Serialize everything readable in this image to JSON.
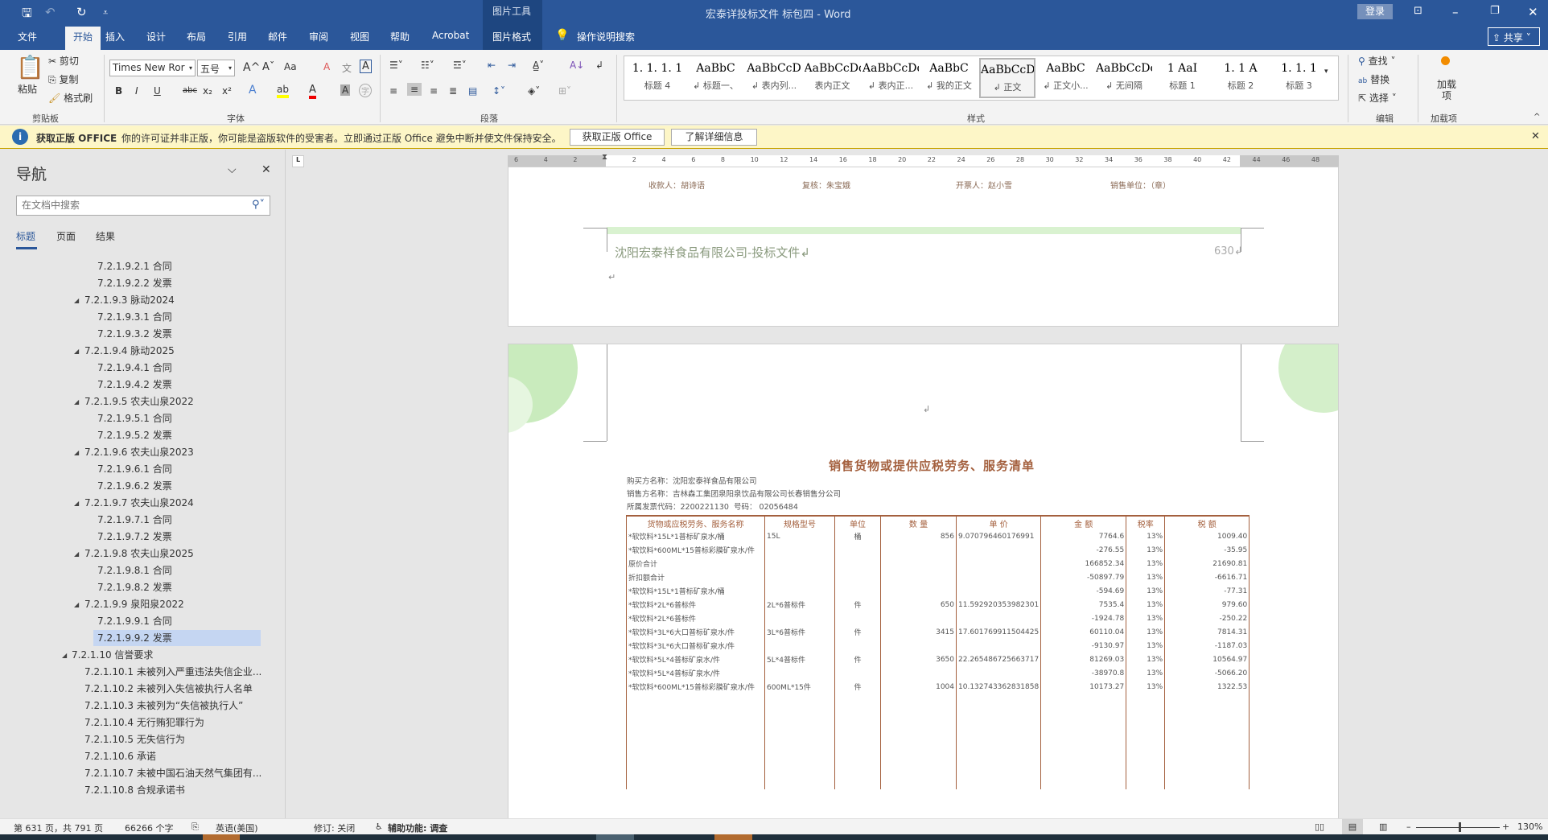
{
  "titlebar": {
    "quick_access": [
      "save-icon",
      "undo-icon",
      "redo-icon",
      "customize-icon"
    ],
    "context_tab_group": "图片工具",
    "title": "宏泰详投标文件 标包四  -  Word",
    "login": "登录",
    "window_controls": [
      "ribbon-display-icon",
      "minimize-icon",
      "restore-icon",
      "close-icon"
    ]
  },
  "tabs": [
    "文件",
    "开始",
    "插入",
    "设计",
    "布局",
    "引用",
    "邮件",
    "审阅",
    "视图",
    "帮助",
    "Acrobat",
    "图片格式"
  ],
  "tell_me": "操作说明搜索",
  "share": "共享",
  "ribbon": {
    "clipboard": {
      "paste": "粘贴",
      "cut": "剪切",
      "copy": "复制",
      "format_painter": "格式刷",
      "label": "剪贴板"
    },
    "font": {
      "name": "Times New Ror",
      "size": "五号",
      "label": "字体",
      "bold": "B",
      "italic": "I",
      "underline": "U",
      "strike": "abc",
      "sub": "x₂",
      "sup": "x²",
      "grow": "A^",
      "shrink": "Aˇ",
      "case": "Aa",
      "clear": "A",
      "phonetic": "文",
      "border": "A",
      "effects": "A",
      "highlight": "ab",
      "color": "A",
      "shading": "A",
      "enclose": "字"
    },
    "paragraph": {
      "label": "段落"
    },
    "styles": {
      "label": "样式",
      "items": [
        {
          "preview": "1. 1. 1. 1",
          "label": "标题 4"
        },
        {
          "preview": "AaBbC",
          "label": "↲ 标题一、"
        },
        {
          "preview": "AaBbCcD",
          "label": "↲ 表内列..."
        },
        {
          "preview": "AaBbCcDdI",
          "label": "表内正文"
        },
        {
          "preview": "AaBbCcDdI",
          "label": "↲ 表内正..."
        },
        {
          "preview": "AaBbC",
          "label": "↲ 我的正文"
        },
        {
          "preview": "AaBbCcDc",
          "label": "↲ 正文"
        },
        {
          "preview": "AaBbC",
          "label": "↲ 正文小..."
        },
        {
          "preview": "AaBbCcDc",
          "label": "↲ 无间隔"
        },
        {
          "preview": "1   AaI",
          "label": "标题 1"
        },
        {
          "preview": "1. 1   A",
          "label": "标题 2"
        },
        {
          "preview": "1. 1. 1",
          "label": "标题 3"
        }
      ],
      "selected_index": 6
    },
    "editing": {
      "find": "查找",
      "replace": "替换",
      "select": "选择",
      "label": "编辑"
    },
    "addins": {
      "button": "加载项",
      "label": "加载项"
    }
  },
  "infobar": {
    "title": "获取正版 OFFICE",
    "message": "你的许可证并非正版，你可能是盗版软件的受害者。立即通过正版 Office 避免中断并使文件保持安全。",
    "button_primary": "获取正版 Office",
    "button_secondary": "了解详细信息"
  },
  "nav": {
    "title": "导航",
    "search_placeholder": "在文档中搜索",
    "tabs": [
      "标题",
      "页面",
      "结果"
    ],
    "items": [
      {
        "text": "7.2.1.9.2.1 合同",
        "level": 3
      },
      {
        "text": "7.2.1.9.2.2 发票",
        "level": 3
      },
      {
        "text": "7.2.1.9.3 脉动2024",
        "level": 2
      },
      {
        "text": "7.2.1.9.3.1 合同",
        "level": 3
      },
      {
        "text": "7.2.1.9.3.2 发票",
        "level": 3
      },
      {
        "text": "7.2.1.9.4 脉动2025",
        "level": 2
      },
      {
        "text": "7.2.1.9.4.1 合同",
        "level": 3
      },
      {
        "text": "7.2.1.9.4.2 发票",
        "level": 3
      },
      {
        "text": "7.2.1.9.5 农夫山泉2022",
        "level": 2
      },
      {
        "text": "7.2.1.9.5.1 合同",
        "level": 3
      },
      {
        "text": "7.2.1.9.5.2 发票",
        "level": 3
      },
      {
        "text": "7.2.1.9.6 农夫山泉2023",
        "level": 2
      },
      {
        "text": "7.2.1.9.6.1 合同",
        "level": 3
      },
      {
        "text": "7.2.1.9.6.2 发票",
        "level": 3
      },
      {
        "text": "7.2.1.9.7 农夫山泉2024",
        "level": 2
      },
      {
        "text": "7.2.1.9.7.1 合同",
        "level": 3
      },
      {
        "text": "7.2.1.9.7.2 发票",
        "level": 3
      },
      {
        "text": "7.2.1.9.8 农夫山泉2025",
        "level": 2
      },
      {
        "text": "7.2.1.9.8.1 合同",
        "level": 3
      },
      {
        "text": "7.2.1.9.8.2 发票",
        "level": 3
      },
      {
        "text": "7.2.1.9.9 泉阳泉2022",
        "level": 2
      },
      {
        "text": "7.2.1.9.9.1 合同",
        "level": 3
      },
      {
        "text": "7.2.1.9.9.2 发票",
        "level": 3,
        "selected": true
      },
      {
        "text": "7.2.1.10 信誉要求",
        "level": 1
      },
      {
        "text": "7.2.1.10.1 未被列入严重违法失信企业...",
        "level": 1.5
      },
      {
        "text": "7.2.1.10.2 未被列入失信被执行人名单",
        "level": 1.5
      },
      {
        "text": "7.2.1.10.3 未被列为“失信被执行人”",
        "level": 1.5
      },
      {
        "text": "7.2.1.10.4 无行贿犯罪行为",
        "level": 1.5
      },
      {
        "text": "7.2.1.10.5 无失信行为",
        "level": 1.5
      },
      {
        "text": "7.2.1.10.6 承诺",
        "level": 1.5
      },
      {
        "text": "7.2.1.10.7 未被中国石油天然气集团有...",
        "level": 1.5
      },
      {
        "text": "7.2.1.10.8 合规承诺书",
        "level": 1.5
      }
    ]
  },
  "ruler": {
    "ticks": [
      "6",
      "4",
      "2",
      "",
      "2",
      "4",
      "6",
      "8",
      "10",
      "12",
      "14",
      "16",
      "18",
      "20",
      "22",
      "24",
      "26",
      "28",
      "30",
      "32",
      "34",
      "36",
      "38",
      "40",
      "42",
      "44",
      "46",
      "48"
    ]
  },
  "page1": {
    "signatures": [
      "收款人：胡诗语",
      "复核：朱宝娥",
      "开票人：赵小雪",
      "销售单位：（章）"
    ],
    "footer_text": "沈阳宏泰祥食品有限公司-投标文件↲",
    "page_number": "630↲"
  },
  "page2": {
    "paragraph_mark": "↲",
    "invoice": {
      "title": "销售货物或提供应税劳务、服务清单",
      "buyer": "购买方名称：沈阳宏泰祥食品有限公司",
      "seller": "销售方名称：吉林森工集团泉阳泉饮品有限公司长春销售分公司",
      "code": "所属发票代码：2200221130",
      "number": "号码：  02056484",
      "headers": [
        "货物或应税劳务、服务名称",
        "规格型号",
        "单位",
        "数 量",
        "单 价",
        "金 额",
        "税率",
        "税 额"
      ],
      "rows": [
        [
          "*软饮料*15L*1普标矿泉水/桶",
          "15L",
          "桶",
          "856",
          "9.070796460176991",
          "7764.6",
          "13%",
          "1009.40"
        ],
        [
          "*软饮料*600ML*15普标彩膜矿泉水/件",
          "",
          "",
          "",
          "",
          "-276.55",
          "13%",
          "-35.95"
        ],
        [
          "原价合计",
          "",
          "",
          "",
          "",
          "166852.34",
          "13%",
          "21690.81"
        ],
        [
          "折扣额合计",
          "",
          "",
          "",
          "",
          "-50897.79",
          "13%",
          "-6616.71"
        ],
        [
          "*软饮料*15L*1普标矿泉水/桶",
          "",
          "",
          "",
          "",
          "-594.69",
          "13%",
          "-77.31"
        ],
        [
          "*软饮料*2L*6普标件",
          "2L*6普标件",
          "件",
          "650",
          "11.592920353982301",
          "7535.4",
          "13%",
          "979.60"
        ],
        [
          "*软饮料*2L*6普标件",
          "",
          "",
          "",
          "",
          "-1924.78",
          "13%",
          "-250.22"
        ],
        [
          "*软饮料*3L*6大口普标矿泉水/件",
          "3L*6普标件",
          "件",
          "3415",
          "17.601769911504425",
          "60110.04",
          "13%",
          "7814.31"
        ],
        [
          "*软饮料*3L*6大口普标矿泉水/件",
          "",
          "",
          "",
          "",
          "-9130.97",
          "13%",
          "-1187.03"
        ],
        [
          "*软饮料*5L*4普标矿泉水/件",
          "5L*4普标件",
          "件",
          "3650",
          "22.265486725663717",
          "81269.03",
          "13%",
          "10564.97"
        ],
        [
          "*软饮料*5L*4普标矿泉水/件",
          "",
          "",
          "",
          "",
          "-38970.8",
          "13%",
          "-5066.20"
        ],
        [
          "*软饮料*600ML*15普标彩膜矿泉水/件",
          "600ML*15件",
          "件",
          "1004",
          "10.132743362831858",
          "10173.27",
          "13%",
          "1322.53"
        ]
      ]
    }
  },
  "status": {
    "page": "第 631 页，共 791 页",
    "words": "66266 个字",
    "language": "英语(美国)",
    "track": "修订: 关闭",
    "accessibility": "辅助功能: 调查",
    "zoom": "130%",
    "zoom_level_percent": 130
  },
  "colors": {
    "brand": "#2b579a",
    "invoice": "#a4603e",
    "footer_green": "#d9f2d0",
    "selection": "#c5d6f2"
  }
}
